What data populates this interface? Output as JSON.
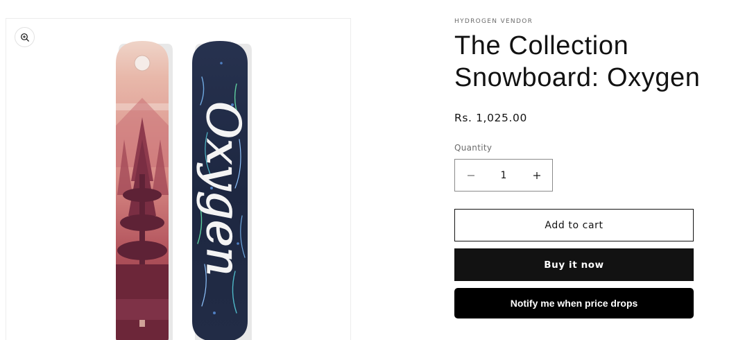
{
  "product": {
    "vendor": "HYDROGEN VENDOR",
    "title": "The Collection Snowboard: Oxygen",
    "price": "Rs. 1,025.00",
    "board_text": "Oxygen"
  },
  "quantity": {
    "label": "Quantity",
    "value": "1"
  },
  "buttons": {
    "add_to_cart": "Add to cart",
    "buy_now": "Buy it now",
    "notify": "Notify me when price drops"
  },
  "icons": {
    "zoom": "zoom-in-icon",
    "decrease": "minus-icon",
    "increase": "plus-icon"
  },
  "colors": {
    "text": "#121212",
    "muted": "#6b6b6b",
    "buy_button": "#121212",
    "notify_button": "#000000",
    "board_left_top": "#e9c3b6",
    "board_left_bottom": "#7a2e3c",
    "board_right": "#1f2a45"
  }
}
